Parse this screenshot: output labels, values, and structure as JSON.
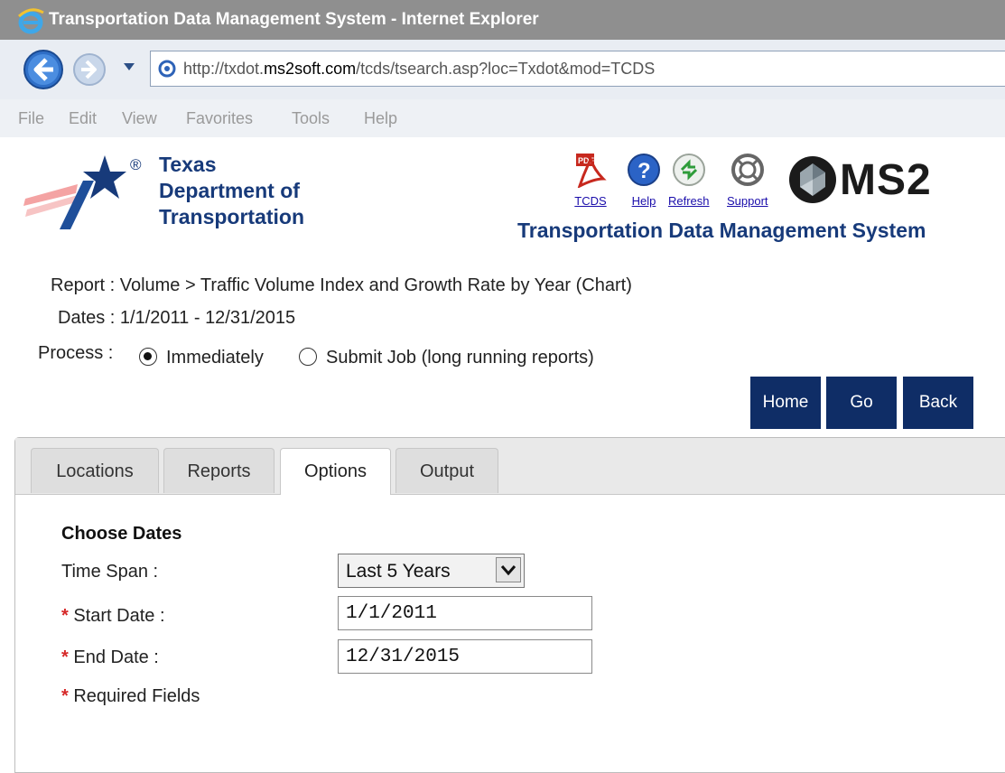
{
  "window": {
    "title": "Transportation Data Management System - Internet Explorer"
  },
  "address_bar": {
    "url_prefix": "http://txdot.",
    "url_domain": "ms2soft.com",
    "url_path": "/tcds/tsearch.asp?loc=Txdot&mod=TCDS"
  },
  "menu": {
    "items": [
      "File",
      "Edit",
      "View",
      "Favorites",
      "Tools",
      "Help"
    ]
  },
  "header": {
    "org_line1": "Texas",
    "org_line2": "Department of",
    "org_line3": "Transportation",
    "registered_mark": "®",
    "tools": [
      {
        "label": "TCDS",
        "icon": "pdf-icon"
      },
      {
        "label": "Help",
        "icon": "help-icon"
      },
      {
        "label": "Refresh",
        "icon": "refresh-icon"
      },
      {
        "label": "Support",
        "icon": "support-icon"
      }
    ],
    "vendor_logo_text": "MS2",
    "system_title": "Transportation Data Management System"
  },
  "report_info": {
    "report_label": "Report :",
    "report_value": "Volume > Traffic Volume Index and Growth Rate by Year (Chart)",
    "dates_label": "Dates :",
    "dates_value": "1/1/2011 - 12/31/2015",
    "process_label": "Process :",
    "process_options": [
      {
        "label": "Immediately",
        "checked": true
      },
      {
        "label": "Submit Job (long running reports)",
        "checked": false
      }
    ]
  },
  "nav_buttons": {
    "home": "Home",
    "go": "Go",
    "back": "Back"
  },
  "tabs": [
    {
      "label": "Locations",
      "active": false
    },
    {
      "label": "Reports",
      "active": false
    },
    {
      "label": "Options",
      "active": true
    },
    {
      "label": "Output",
      "active": false
    }
  ],
  "options": {
    "section_title": "Choose Dates",
    "time_span_label": "Time Span :",
    "time_span_value": "Last 5 Years",
    "start_date_label": "Start Date :",
    "start_date_value": "1/1/2011",
    "end_date_label": "End Date :",
    "end_date_value": "12/31/2015",
    "required_marker": "*",
    "required_note": "Required Fields"
  },
  "colors": {
    "brand_blue": "#173a7a",
    "button_navy": "#0f2d66",
    "required_red": "#d62828"
  }
}
